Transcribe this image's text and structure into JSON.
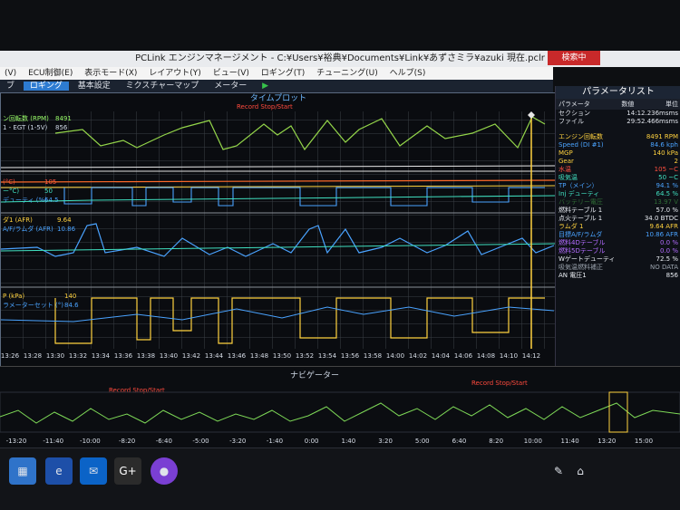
{
  "app_title": "PCLink エンジンマネージメント - C:¥Users¥裕典¥Documents¥Link¥あずさミラ¥azuki 現在.pclr",
  "title_button": "検索中",
  "menu": [
    "(V)",
    "ECU制御(E)",
    "表示モード(X)",
    "レイアウト(Y)",
    "ビュー(V)",
    "ロギング(T)",
    "チューニング(U)",
    "ヘルプ(S)"
  ],
  "tabs": [
    "ブ",
    "ロギング",
    "基本設定",
    "ミクスチャーマップ",
    "メーター"
  ],
  "plot": {
    "title": "タイムプロット",
    "record_label": "Record Stop/Start",
    "x_ticks": [
      "13:26",
      "13:28",
      "13:30",
      "13:32",
      "13:34",
      "13:36",
      "13:38",
      "13:40",
      "13:42",
      "13:44",
      "13:46",
      "13:48",
      "13:50",
      "13:52",
      "13:54",
      "13:56",
      "13:58",
      "14:00",
      "14:02",
      "14:04",
      "14:06",
      "14:08",
      "14:10",
      "14:12"
    ],
    "lane1": {
      "label1": "ン回転数 (RPM)",
      "value1": "8491",
      "label2": "1 - EGT (1-5V)",
      "value2": "856"
    },
    "lane2": {
      "label1": "(°C)",
      "value1": "105",
      "label2": "ー°C)",
      "value2": "50",
      "label3": "デューティ (%)",
      "value3": "64.5"
    },
    "lane3": {
      "label1": "ダ1 (AFR)",
      "value1": "9.64",
      "label2": "A/F/ラムダ (AFR)",
      "value2": "10.86"
    },
    "lane4": {
      "label1": "P (kPa)",
      "value1": "140",
      "label2": "ラメーターセット (°)",
      "value2": "84.6"
    }
  },
  "sidebar": {
    "title": "パラメータリスト",
    "head": [
      "パラメータ",
      "数値",
      "単位"
    ],
    "meta": [
      {
        "name": "セクション",
        "value": "14:12.236msms"
      },
      {
        "name": "ファイル",
        "value": "29:52.466msms"
      }
    ],
    "params": [
      {
        "name": "エンジン回転数",
        "value": "8491",
        "unit": "RPM",
        "color": "#ffd23f"
      },
      {
        "name": "Speed (DI #1)",
        "value": "84.6",
        "unit": "kph",
        "color": "#4aa3ff"
      },
      {
        "name": "MGP",
        "value": "140",
        "unit": "kPa",
        "color": "#ffd23f"
      },
      {
        "name": "Gear",
        "value": "2",
        "unit": "",
        "color": "#ffd23f"
      },
      {
        "name": "水温",
        "value": "105",
        "unit": "~C",
        "color": "#ff5040"
      },
      {
        "name": "吸気温",
        "value": "50",
        "unit": "~C",
        "color": "#40e0c0"
      },
      {
        "name": "TP（メイン）",
        "value": "94.1",
        "unit": "%",
        "color": "#4aa3ff"
      },
      {
        "name": "Inj デューティ",
        "value": "64.5",
        "unit": "%",
        "color": "#40e0c0"
      },
      {
        "name": "バッテリー電圧",
        "value": "13.97",
        "unit": "V",
        "color": "#2f6b35"
      },
      {
        "name": "燃料テーブル 1",
        "value": "57.0",
        "unit": "%",
        "color": "#e8ecf2"
      },
      {
        "name": "点火テーブル 1",
        "value": "34.0",
        "unit": "BTDC",
        "color": "#e8ecf2"
      },
      {
        "name": "ラムダ 1",
        "value": "9.64",
        "unit": "AFR",
        "color": "#ffd23f"
      },
      {
        "name": "目標A/F/ラムダ",
        "value": "10.86",
        "unit": "AFR",
        "color": "#4aa3ff"
      },
      {
        "name": "燃料4Dテーブル",
        "value": "0.0",
        "unit": "%",
        "color": "#b36cff"
      },
      {
        "name": "燃料5Dテーブル",
        "value": "0.0",
        "unit": "%",
        "color": "#b36cff"
      },
      {
        "name": "Wゲートデューティ",
        "value": "72.5",
        "unit": "%",
        "color": "#e8ecf2"
      },
      {
        "name": "吸気温燃料補正",
        "value": "NO DATA",
        "unit": "",
        "color": "#9aa3ad"
      },
      {
        "name": "AN 電圧1",
        "value": "856",
        "unit": "",
        "color": "#e8ecf2"
      }
    ]
  },
  "navigator": {
    "title": "ナビゲーター",
    "record_left": "Record Stop/Start",
    "record_right": "Record Stop/Start",
    "x_ticks": [
      "-13:20",
      "-11:40",
      "-10:00",
      "-8:20",
      "-6:40",
      "-5:00",
      "-3:20",
      "-1:40",
      "0:00",
      "1:40",
      "3:20",
      "5:00",
      "6:40",
      "8:20",
      "10:00",
      "11:40",
      "13:20",
      "15:00"
    ]
  },
  "taskbar": {
    "g_label": "G+"
  }
}
